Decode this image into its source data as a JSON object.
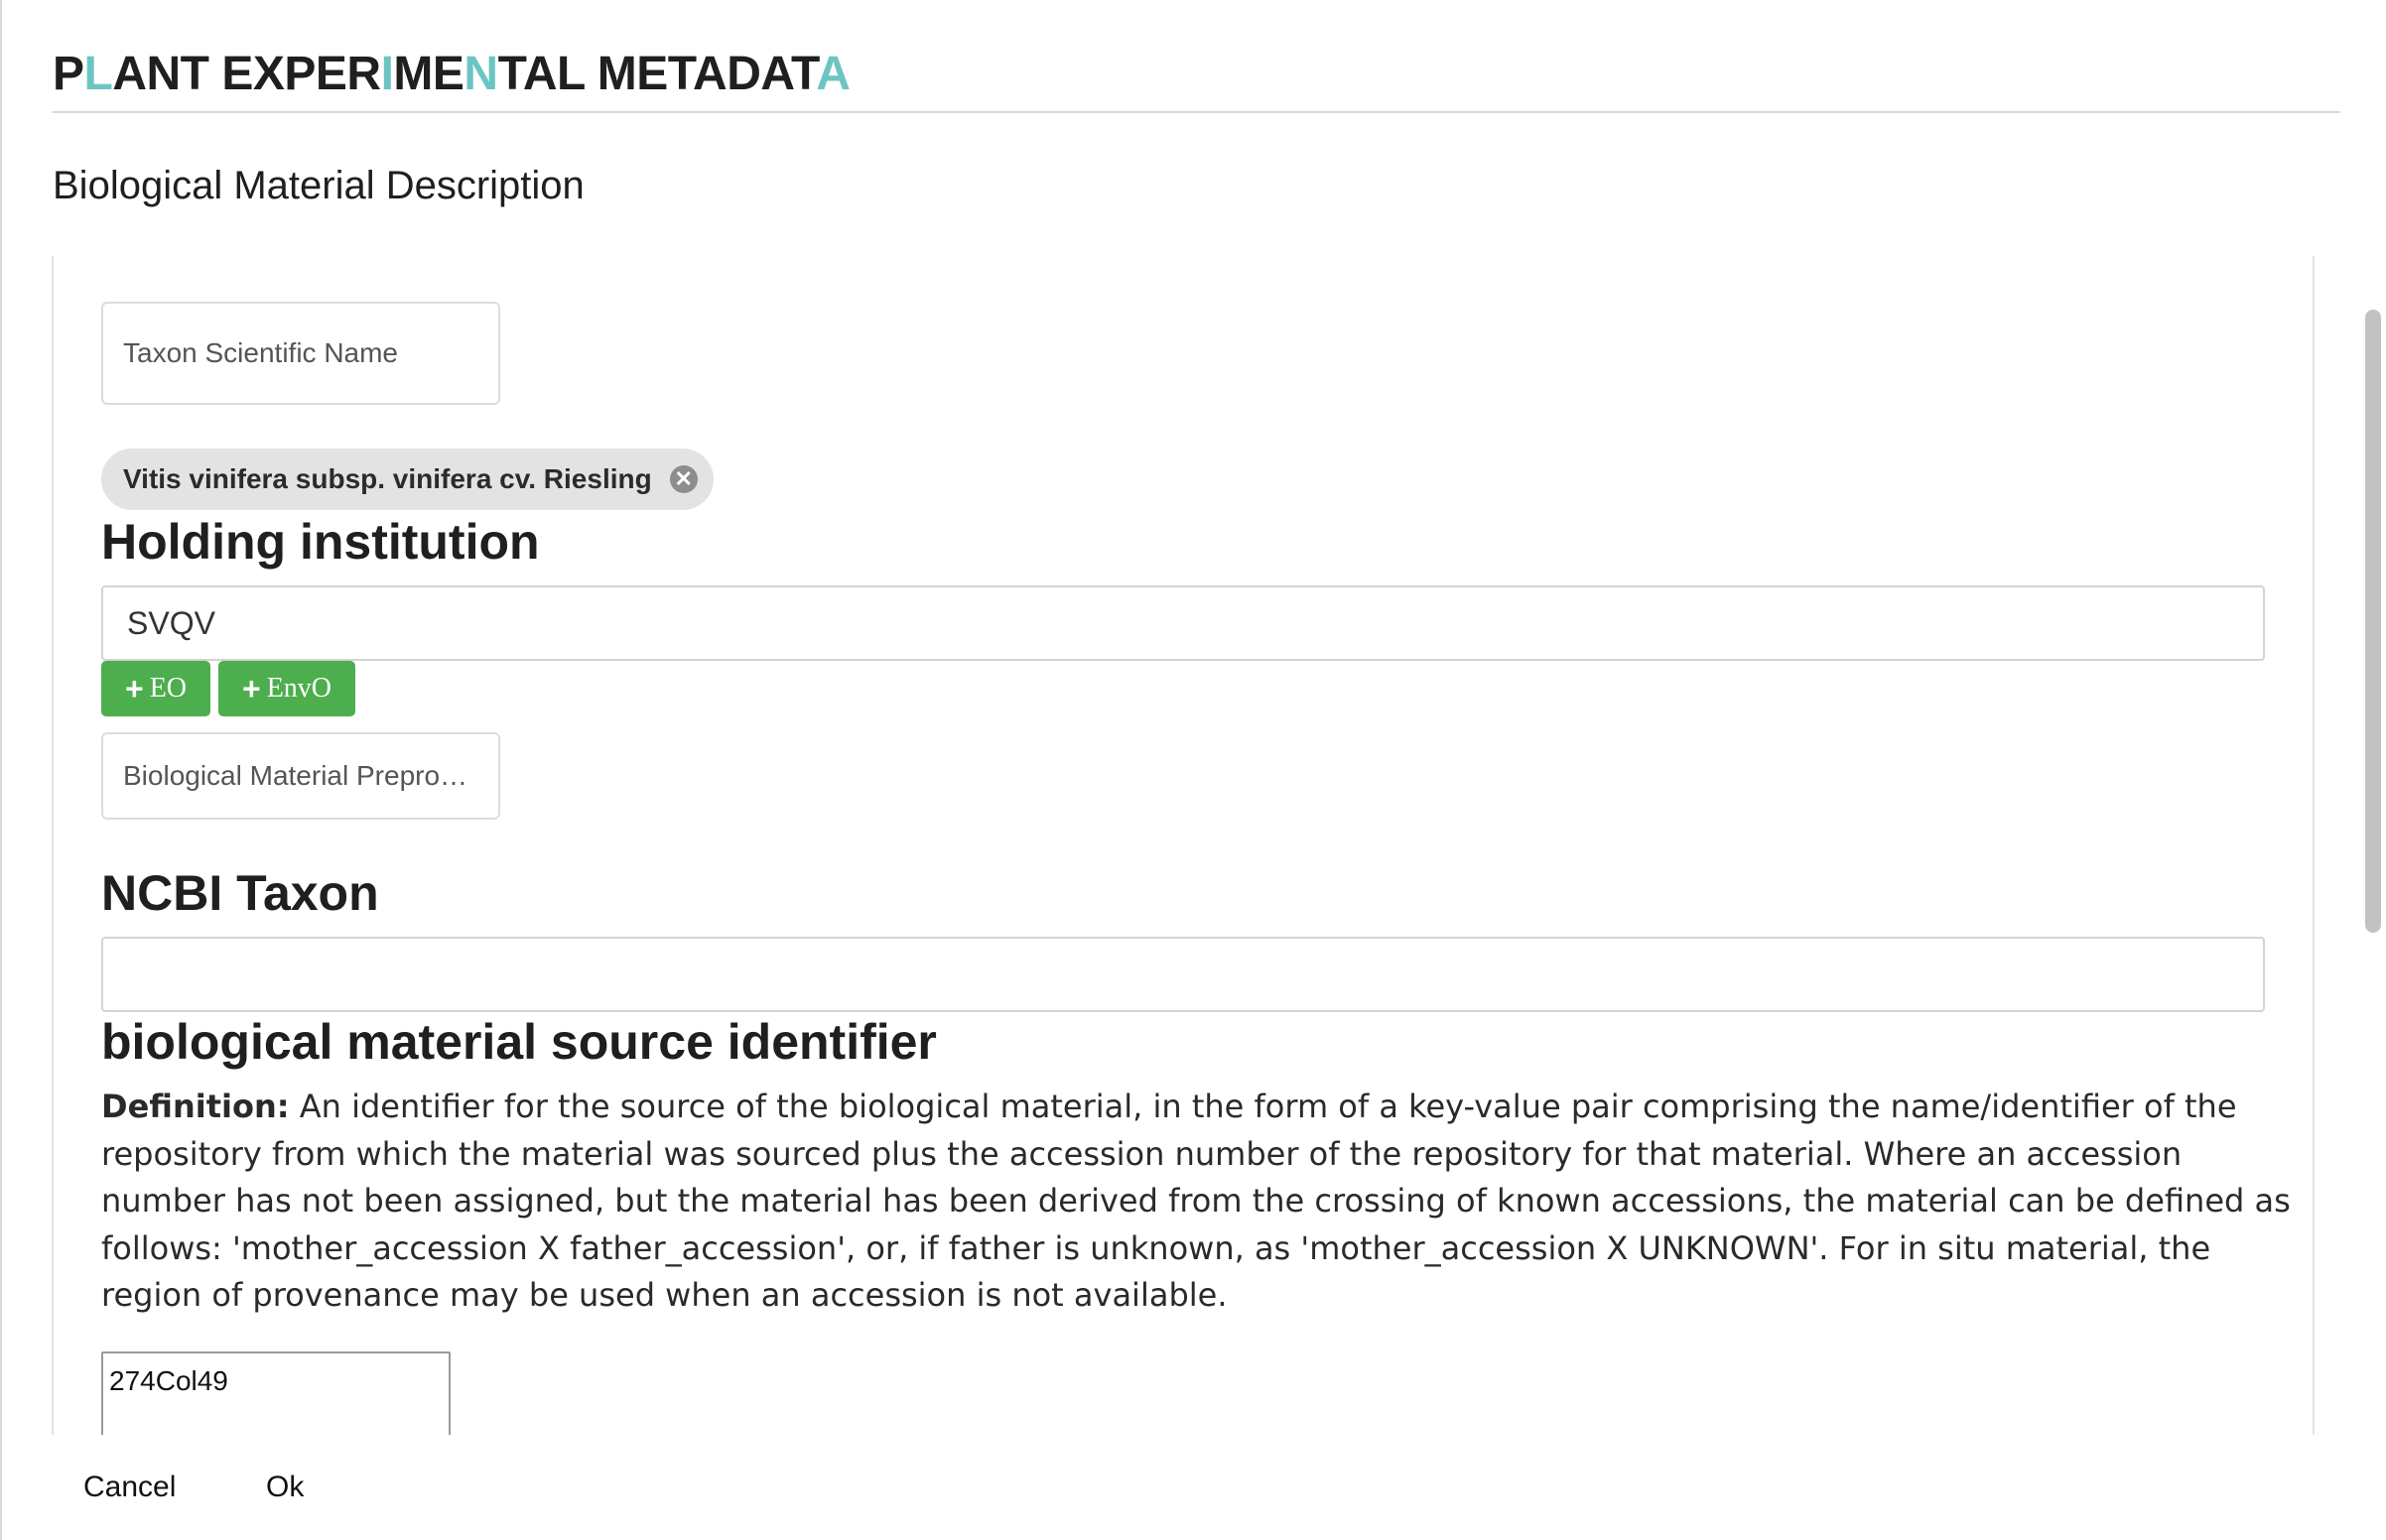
{
  "app": {
    "title_parts": [
      {
        "text": "P",
        "accent": false
      },
      {
        "text": "L",
        "accent": true
      },
      {
        "text": "ANT EXPER",
        "accent": false
      },
      {
        "text": "I",
        "accent": true
      },
      {
        "text": "ME",
        "accent": false
      },
      {
        "text": "N",
        "accent": true
      },
      {
        "text": "TAL METADAT",
        "accent": false
      },
      {
        "text": "A",
        "accent": true
      }
    ],
    "accent_color": "#6cc5c3"
  },
  "dialog": {
    "subtitle": "Biological Material Description"
  },
  "form": {
    "taxon_scientific_name": {
      "label": "Taxon Scientific Name"
    },
    "selected_taxon_chip": {
      "label": "Vitis vinifera subsp. vinifera cv. Riesling",
      "remove_icon": "close-circle-icon"
    },
    "holding_institution": {
      "heading": "Holding institution",
      "value": "SVQV"
    },
    "ontology_buttons": [
      {
        "label": "EO",
        "icon": "plus-icon"
      },
      {
        "label": "EnvO",
        "icon": "plus-icon"
      }
    ],
    "preprocessing": {
      "label": "Biological Material Prepro…"
    },
    "ncbi_taxon": {
      "heading": "NCBI Taxon",
      "value": ""
    },
    "source_identifier": {
      "heading": "biological material source identifier",
      "definition_label": "Definition:",
      "definition_text": " An identifier for the source of the biological material, in the form of a key-value pair comprising the name/identifier of the repository from which the material was sourced plus the accession number of the repository for that material. Where an accession number has not been assigned, but the material has been derived from the crossing of known accessions, the material can be defined as follows: 'mother_accession X father_accession', or, if father is unknown, as 'mother_accession X UNKNOWN'. For in situ material, the region of provenance may be used when an accession is not available.",
      "value": "274Col49"
    }
  },
  "footer": {
    "cancel_label": "Cancel",
    "ok_label": "Ok"
  },
  "colors": {
    "button_green": "#4cae4c",
    "chip_background": "#e3e3e3"
  }
}
